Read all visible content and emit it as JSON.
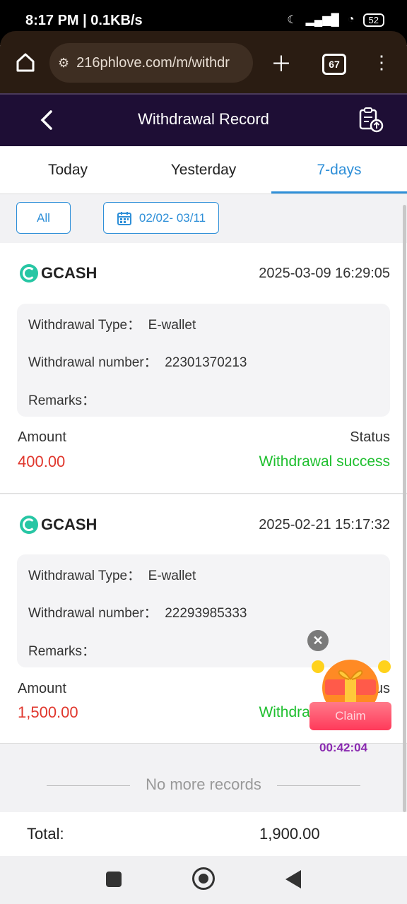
{
  "status_bar": {
    "time": "8:17 PM | 0.1KB/s",
    "battery": "52"
  },
  "browser": {
    "url": "216phlove.com/m/withdr",
    "tab_count": "67"
  },
  "header": {
    "title": "Withdrawal Record"
  },
  "tabs": [
    {
      "label": "Today"
    },
    {
      "label": "Yesterday"
    },
    {
      "label": "7-days",
      "active": true
    }
  ],
  "filter": {
    "all_label": "All",
    "date_range": "02/02- 03/11"
  },
  "records": [
    {
      "method": "GCASH",
      "datetime": "2025-03-09 16:29:05",
      "type_label": "Withdrawal Type：",
      "type_value": "E-wallet",
      "number_label": "Withdrawal number：",
      "number_value": "22301370213",
      "remarks_label": "Remarks：",
      "amount_label": "Amount",
      "amount_value": "400.00",
      "status_label": "Status",
      "status_value": "Withdrawal success"
    },
    {
      "method": "GCASH",
      "datetime": "2025-02-21 15:17:32",
      "type_label": "Withdrawal Type：",
      "type_value": "E-wallet",
      "number_label": "Withdrawal number：",
      "number_value": "22293985333",
      "remarks_label": "Remarks：",
      "amount_label": "Amount",
      "amount_value": "1,500.00",
      "status_label": "Status",
      "status_value": "Withdrawal success"
    }
  ],
  "no_more": "No more records",
  "total": {
    "label": "Total:",
    "value": "1,900.00"
  },
  "promo": {
    "claim_label": "Claim",
    "countdown": "00:42:04"
  },
  "colors": {
    "accent": "#2e8fd8",
    "header_bg": "#1e0e35",
    "amount": "#e0362c",
    "success": "#1fbf2f"
  }
}
